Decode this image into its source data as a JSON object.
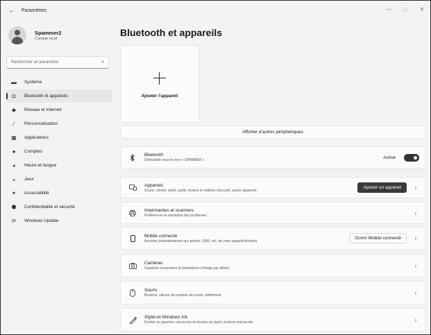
{
  "window": {
    "title": "Paramètres",
    "back_icon": "←",
    "controls": {
      "minimize": "—",
      "maximize": "□",
      "close": "✕"
    }
  },
  "profile": {
    "name": "Spammer2",
    "account_type": "Compte local"
  },
  "search": {
    "placeholder": "Rechercher un paramètre",
    "icon": "⌕"
  },
  "nav": [
    {
      "label": "Système",
      "icon": "▬"
    },
    {
      "label": "Bluetooth et appareils",
      "icon": "◘",
      "active": true
    },
    {
      "label": "Réseau et Internet",
      "icon": "◆"
    },
    {
      "label": "Personnalisation",
      "icon": "∕"
    },
    {
      "label": "Applications",
      "icon": "▦"
    },
    {
      "label": "Comptes",
      "icon": "●"
    },
    {
      "label": "Heure et langue",
      "icon": "◕"
    },
    {
      "label": "Jeux",
      "icon": "◒"
    },
    {
      "label": "Accessibilité",
      "icon": "✦"
    },
    {
      "label": "Confidentialité et sécurité",
      "icon": "⬟"
    },
    {
      "label": "Windows Update",
      "icon": "⟳"
    }
  ],
  "main": {
    "title": "Bluetooth et appareils",
    "add_device_tile_label": "Ajouter l'appareil",
    "more_devices_label": "Afficher d'autres périphériques",
    "bluetooth": {
      "title": "Bluetooth",
      "subtitle": "Détectable sous le nom « SPAMMER »",
      "status": "Activé",
      "enabled": true
    },
    "devices": {
      "title": "Appareils",
      "subtitle": "Souris, clavier, stylet, audio, écrans et stations d'accueil, autres appareils",
      "button": "Ajouter un appareil"
    },
    "printers": {
      "title": "Imprimantes et scanners",
      "subtitle": "Préférences et résolution des problèmes"
    },
    "mobile": {
      "title": "Mobile connecté",
      "subtitle": "Accédez instantanément aux photos, SMS, etc. de votre appareil Android",
      "button": "Ouvrir Mobile connecté"
    },
    "cameras": {
      "title": "Caméras",
      "subtitle": "Caméras connectées et paramètres d'image par défaut"
    },
    "mouse": {
      "title": "Souris",
      "subtitle": "Boutons, vitesse de pointeur de souris, défilement"
    },
    "pen": {
      "title": "Stylet et Windows Ink",
      "subtitle": "Droitier ou gaucher, raccourcis du bouton du stylet, écriture manuscrite"
    },
    "chevron": "›"
  }
}
